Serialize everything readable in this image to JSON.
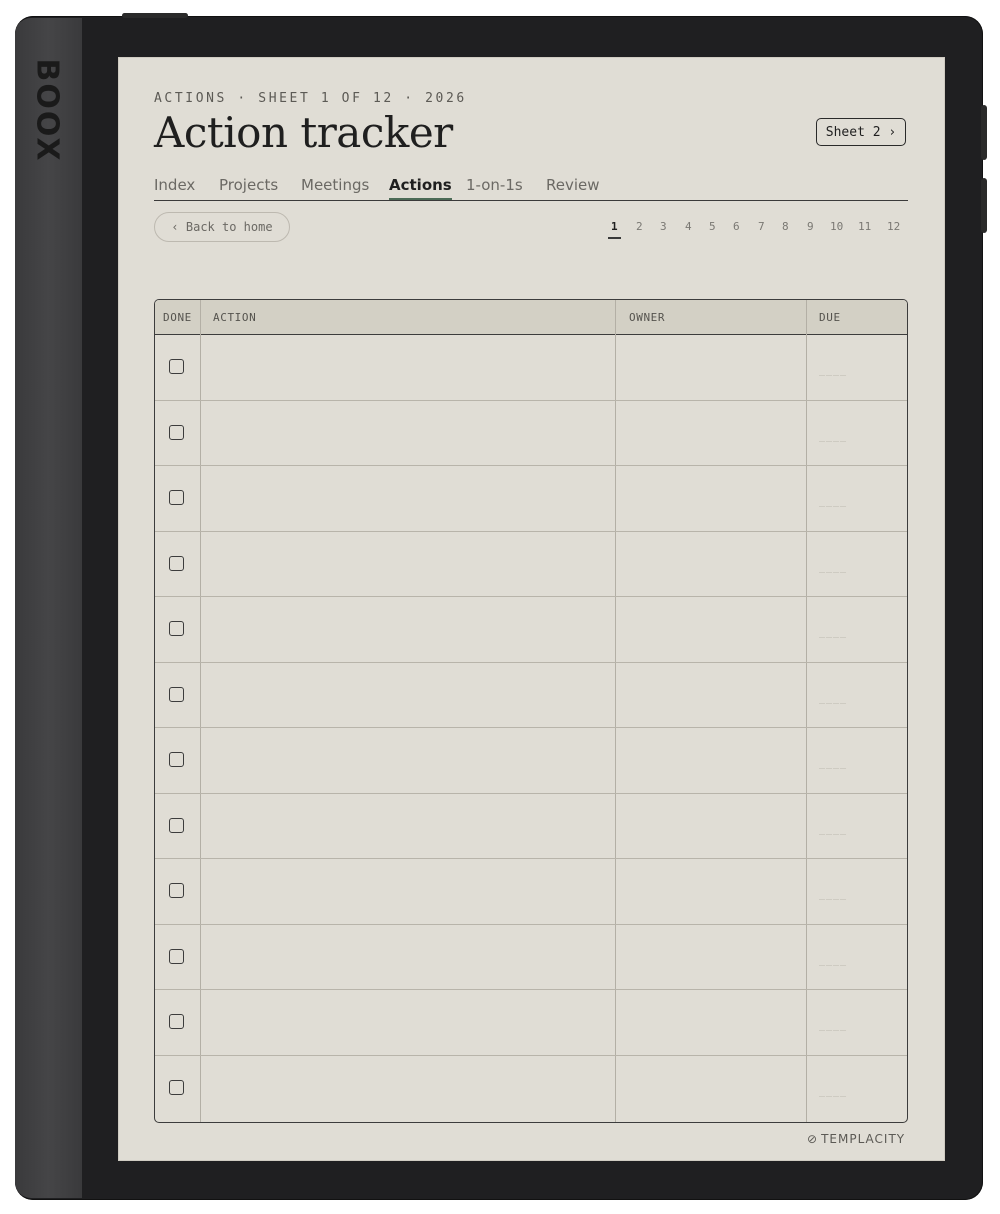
{
  "device": {
    "brand": "BOOX"
  },
  "header": {
    "kicker": "ACTIONS · SHEET 1 OF 12 · 2026",
    "title": "Action tracker",
    "next_sheet_label": "Sheet 2 ›"
  },
  "tabs": [
    {
      "label": "Index",
      "active": false
    },
    {
      "label": "Projects",
      "active": false
    },
    {
      "label": "Meetings",
      "active": false
    },
    {
      "label": "Actions",
      "active": true
    },
    {
      "label": "1-on-1s",
      "active": false
    },
    {
      "label": "Review",
      "active": false
    }
  ],
  "back_label": "‹ Back to home",
  "pager": {
    "current": 1,
    "pages": [
      "1",
      "2",
      "3",
      "4",
      "5",
      "6",
      "7",
      "8",
      "9",
      "10",
      "11",
      "12"
    ]
  },
  "table": {
    "columns": [
      "DONE",
      "ACTION",
      "OWNER",
      "DUE"
    ],
    "row_count": 12,
    "due_placeholder": "____"
  },
  "footer": {
    "logo_text": "TEMPLACITY"
  }
}
